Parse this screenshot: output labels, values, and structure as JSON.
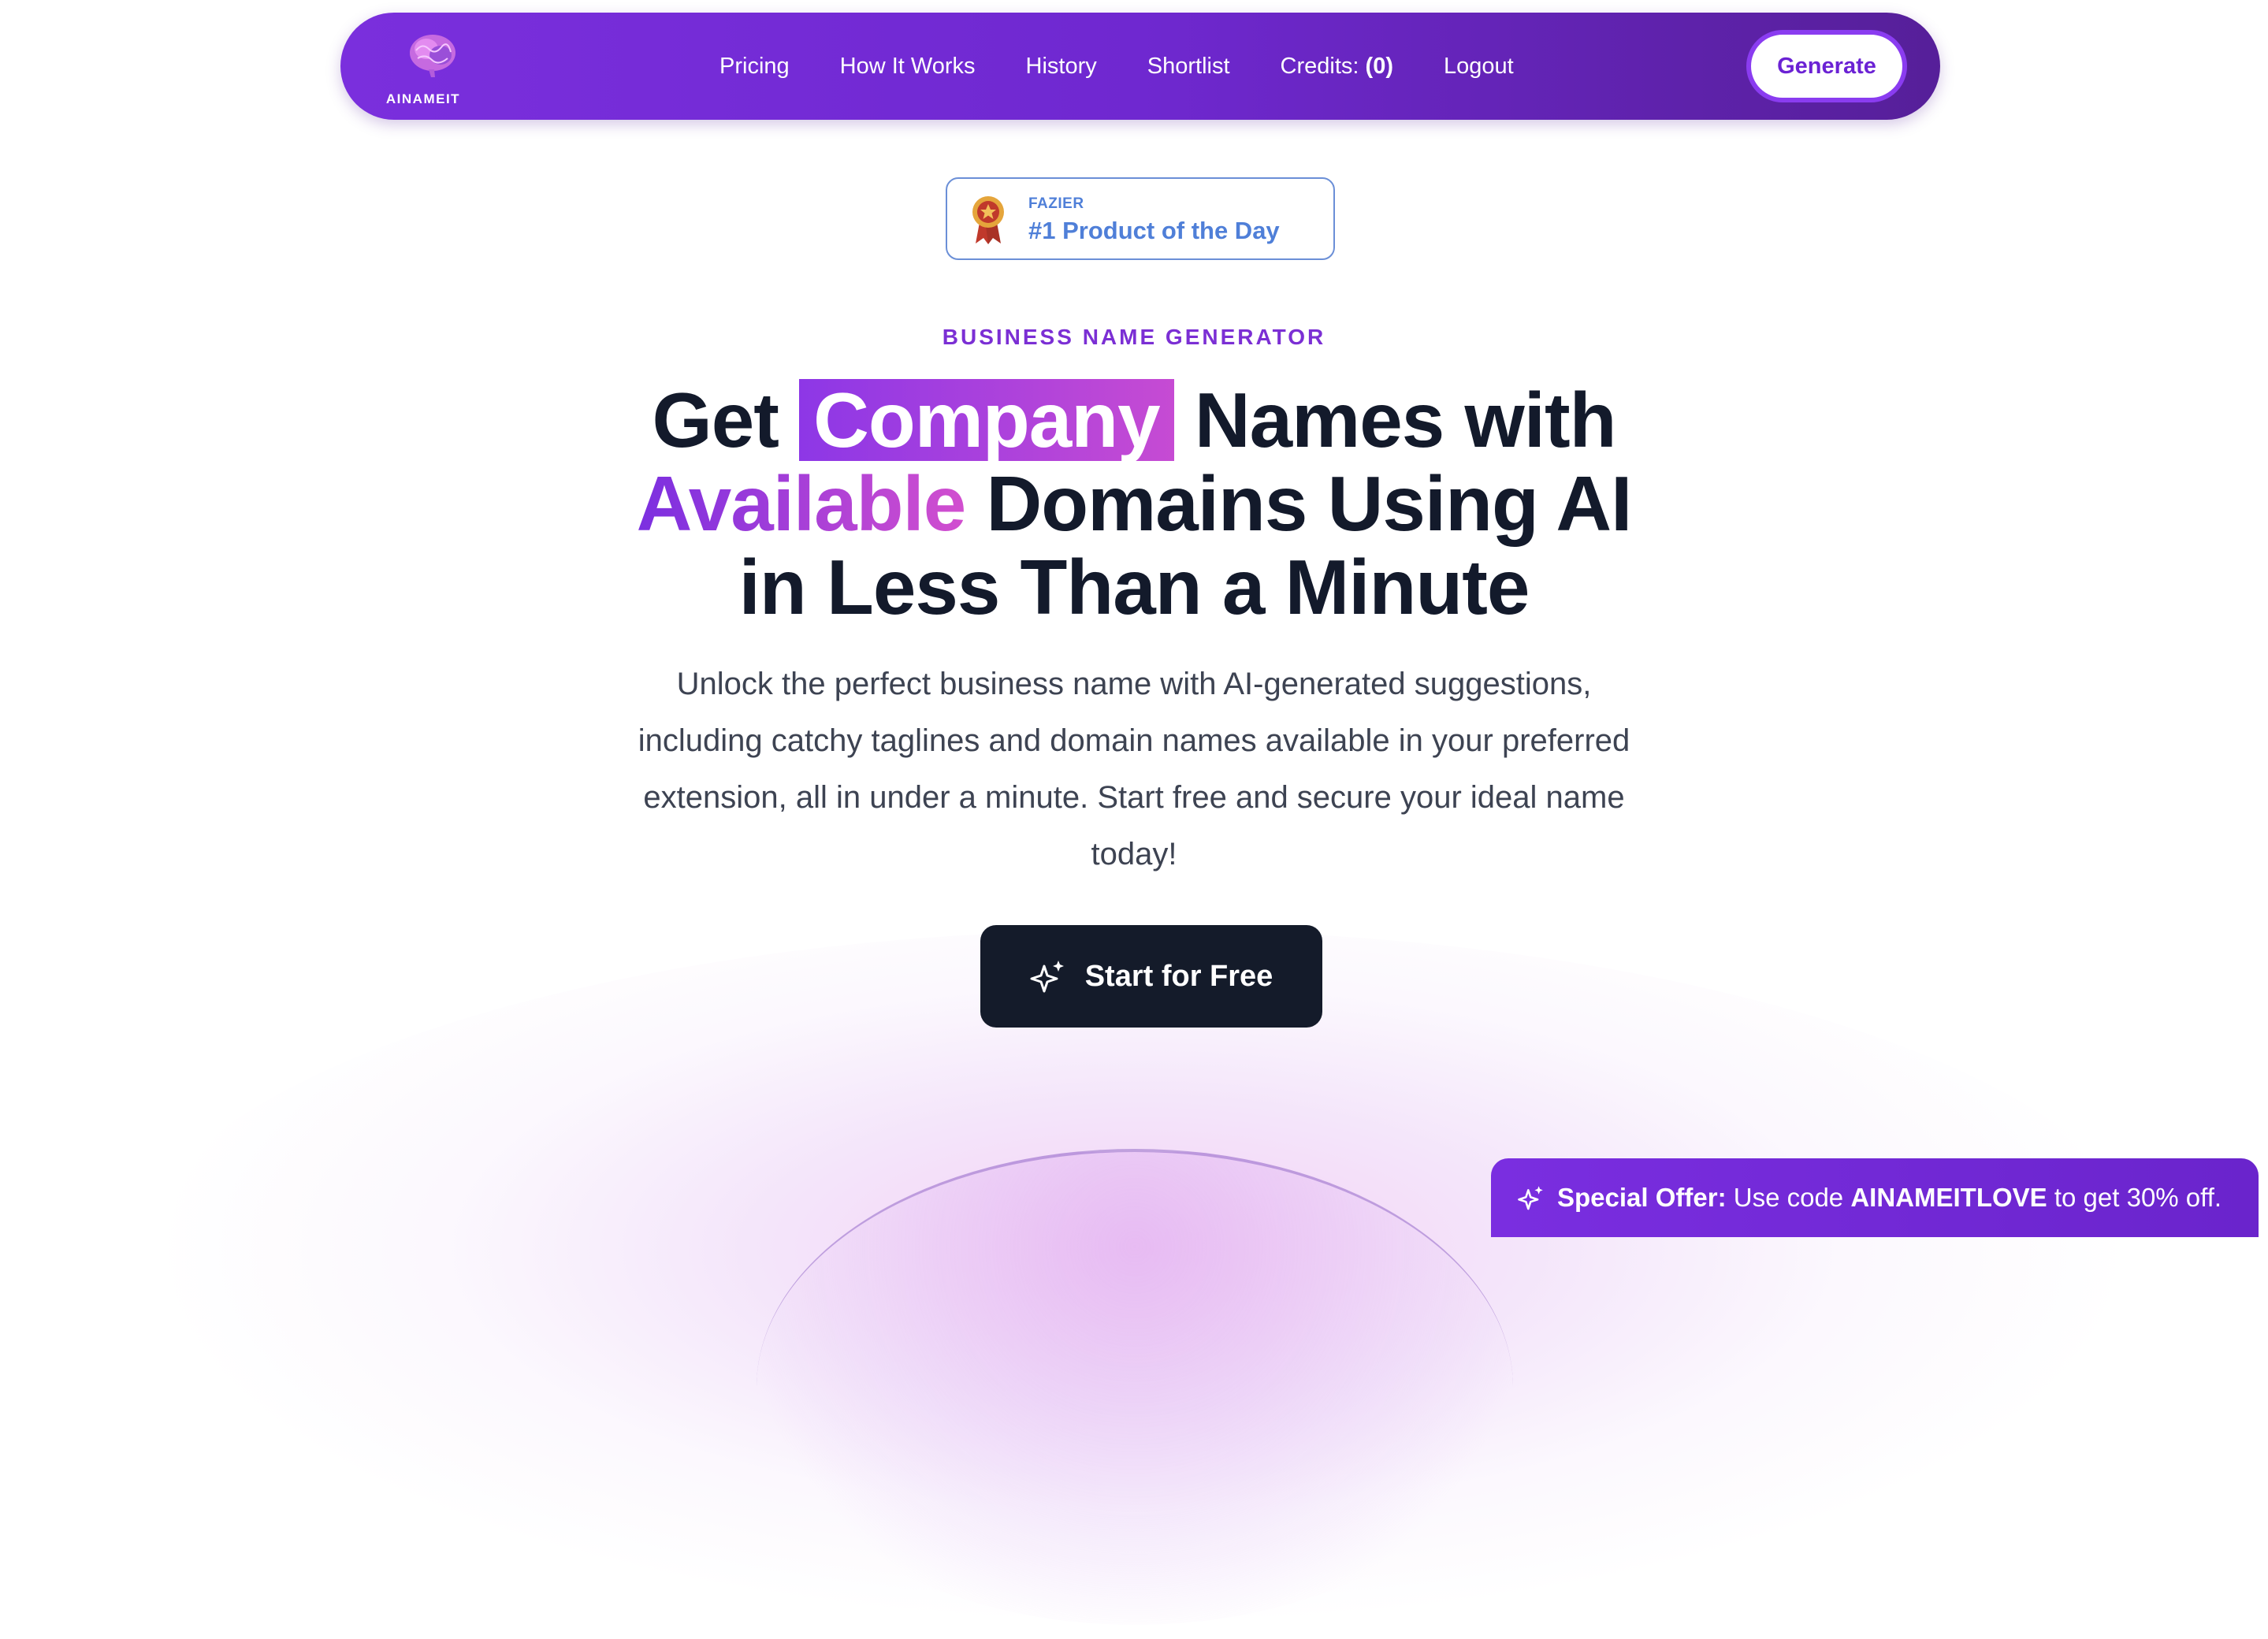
{
  "brand": {
    "logo_text": "AINAMEIT"
  },
  "nav": {
    "links": [
      "Pricing",
      "How It Works",
      "History",
      "Shortlist"
    ],
    "credits_label": "Credits:",
    "credits_value": "(0)",
    "logout": "Logout",
    "generate_button": "Generate"
  },
  "badge": {
    "kicker": "FAZIER",
    "title": "#1 Product of the Day",
    "icon": "medal-icon"
  },
  "hero": {
    "eyebrow": "BUSINESS NAME GENERATOR",
    "headline": {
      "part1": "Get",
      "highlight_box": "Company",
      "part2": "Names with",
      "highlight_gradient": "Available",
      "part3": "Domains Using AI",
      "line3": "in Less Than a Minute"
    },
    "subtitle": "Unlock the perfect business name with AI-generated suggestions, including catchy taglines and domain names available in your preferred extension, all in under a minute. Start free and secure your ideal name today!",
    "cta_label": "Start for Free",
    "cta_icon": "sparkles-icon"
  },
  "offer": {
    "label": "Special Offer:",
    "text_before": "Use code",
    "code": "AINAMEITLOVE",
    "text_after": "to get 30% off.",
    "icon": "sparkles-icon"
  },
  "colors": {
    "nav_start": "#7a2fdd",
    "nav_end": "#561f99",
    "accent": "#7b2fd4",
    "badge_blue": "#4f7fd8",
    "cta_dark": "#141b2a"
  }
}
